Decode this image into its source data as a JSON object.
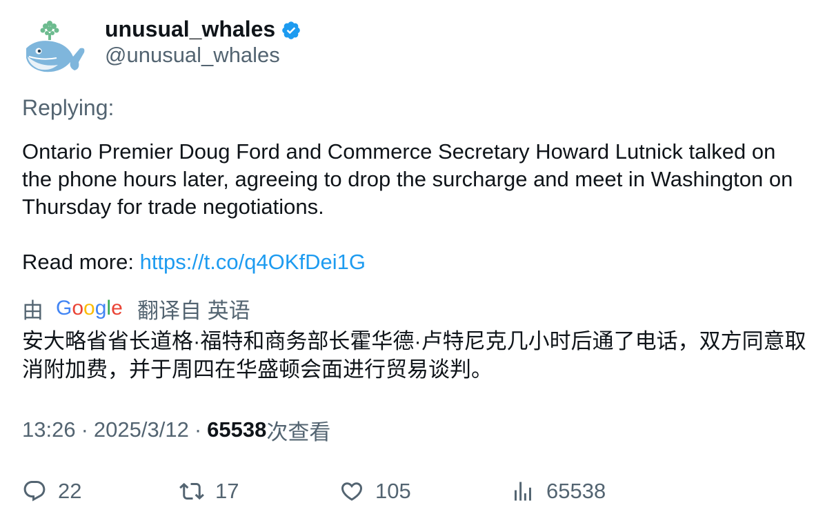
{
  "author": {
    "display_name": "unusual_whales",
    "handle": "@unusual_whales",
    "verified_icon": "verified-badge-icon",
    "avatar_icon": "whale-avatar-icon"
  },
  "replying_label": "Replying:",
  "tweet": {
    "text": "Ontario Premier Doug Ford and Commerce Secretary Howard Lutnick talked on the phone hours later, agreeing to drop the surcharge and meet in Washington on Thursday for trade negotiations.",
    "read_more_label": "Read more: ",
    "link": "https://t.co/q4OKfDei1G"
  },
  "translation_header": {
    "prefix": "由",
    "provider": "Google",
    "suffix": "翻译自 英语"
  },
  "translation_text": "安大略省省长道格·福特和商务部长霍华德·卢特尼克几小时后通了电话，双方同意取消附加费，并于周四在华盛顿会面进行贸易谈判。",
  "meta": {
    "time": "13:26",
    "dot1": "·",
    "date": "2025/3/12",
    "dot2": "·",
    "views": "65538",
    "views_label": "次查看"
  },
  "actions": {
    "replies": "22",
    "retweets": "17",
    "likes": "105",
    "views": "65538"
  },
  "colors": {
    "accent": "#1d9bf0",
    "secondary_text": "#536471",
    "primary_text": "#0f1419"
  }
}
